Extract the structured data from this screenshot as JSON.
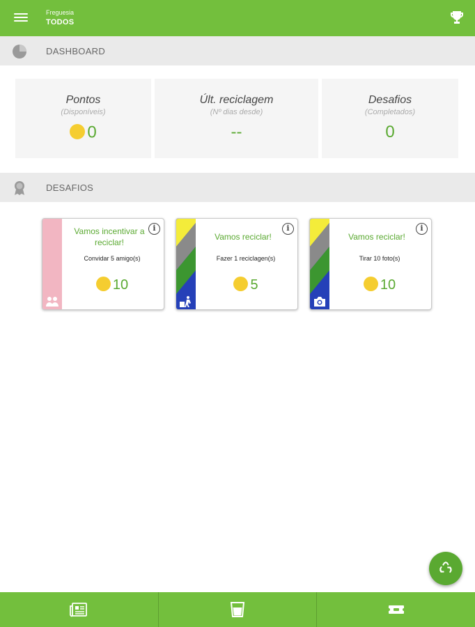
{
  "app": {
    "subtitle": "Freguesia",
    "title": "TODOS"
  },
  "dashboard": {
    "header": "DASHBOARD",
    "stats": [
      {
        "title": "Pontos",
        "sub": "(Disponíveis)",
        "value": "0"
      },
      {
        "title": "Últ. reciclagem",
        "sub": "(Nº dias desde)",
        "value": "--"
      },
      {
        "title": "Desafios",
        "sub": "(Completados)",
        "value": "0"
      }
    ]
  },
  "challenges": {
    "header": "DESAFIOS",
    "cards": [
      {
        "title": "Vamos incentivar a reciclar!",
        "desc": "Convidar 5 amigo(s)",
        "points": "10",
        "icon": "friends-icon",
        "strip": "pink"
      },
      {
        "title": "Vamos reciclar!",
        "desc": "Fazer 1 reciclagen(s)",
        "points": "5",
        "icon": "recycle-person-icon",
        "strip": "multicolor"
      },
      {
        "title": "Vamos reciclar!",
        "desc": "Tirar 10 foto(s)",
        "points": "10",
        "icon": "camera-icon",
        "strip": "multicolor"
      }
    ]
  },
  "bottom_nav": [
    {
      "icon": "news-icon"
    },
    {
      "icon": "bin-icon"
    },
    {
      "icon": "ticket-icon"
    }
  ],
  "fab": {
    "icon": "recycle-icon"
  },
  "colors": {
    "primary": "#73bf3d",
    "accent_text": "#5aa931",
    "coin": "#f5cd30",
    "header_bg": "#eaeaea",
    "strip_pink": "#f2b6c2",
    "strip_yellow": "#f4ec3a",
    "strip_gray": "#8a8a8a",
    "strip_green": "#3c9630",
    "strip_blue": "#2540b8"
  }
}
